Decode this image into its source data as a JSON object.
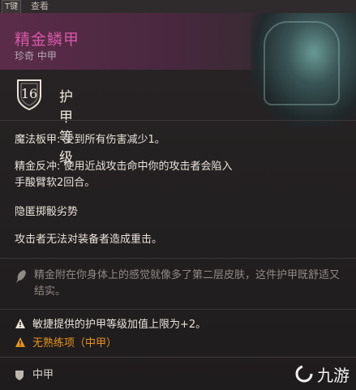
{
  "topbar": {
    "key_hint": "T键",
    "key_label": "查看"
  },
  "item": {
    "name": "精金鳞甲",
    "rarity_type": "珍奇 中甲",
    "armor_class": "16",
    "armor_class_label": "护甲等级"
  },
  "stats": [
    "魔法板甲: 受到所有伤害减少1。",
    "精金反冲: 使用近战攻击命中你的攻击者会陷入",
    "手酸臂软2回合。",
    "隐匿掷骰劣势",
    "攻击者无法对装备者造成重击。"
  ],
  "flavor": "精金附在你身体上的感觉就像多了第二层皮肤，这件护甲既舒适又结实。",
  "warnings": [
    {
      "text": "敏捷提供的护甲等级加值上限为+2。",
      "color": "#e8e2da"
    },
    {
      "text": "无熟练项（中甲）",
      "color": "#e8941c"
    }
  ],
  "footer": {
    "armor_type": "中甲"
  },
  "watermark": {
    "text": "九游"
  },
  "colors": {
    "title": "#d858a6",
    "warning_orange": "#e8941c"
  }
}
